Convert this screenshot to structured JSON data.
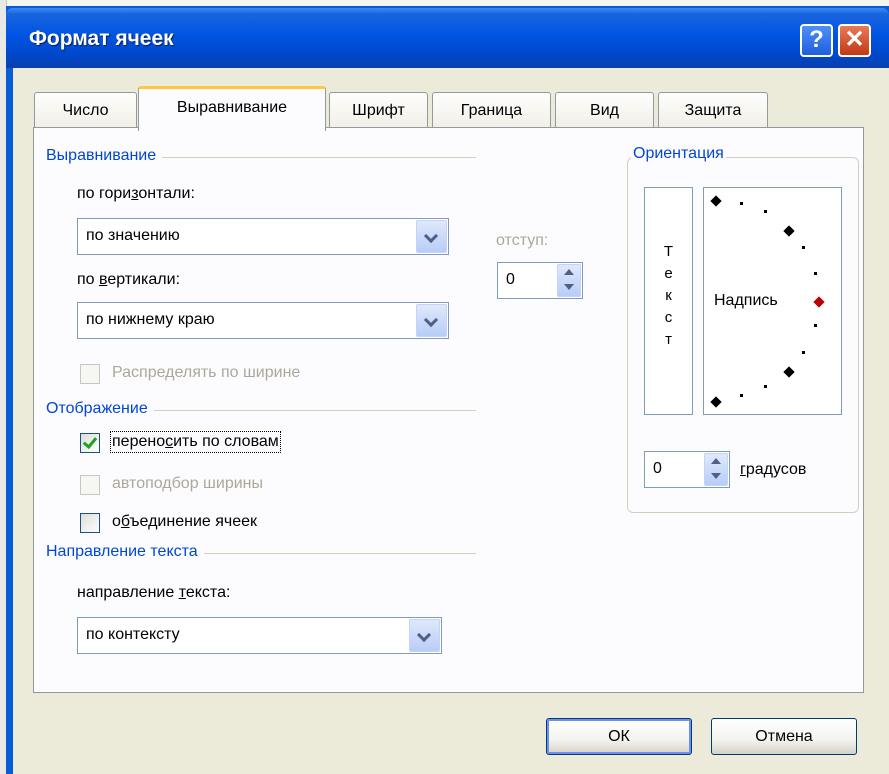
{
  "window": {
    "title": "Формат ячеек"
  },
  "title_buttons": {
    "help": "?",
    "close": "✕"
  },
  "tabs": [
    {
      "label": "Число",
      "active": false
    },
    {
      "label": "Выравнивание",
      "active": true
    },
    {
      "label": "Шрифт",
      "active": false
    },
    {
      "label": "Граница",
      "active": false
    },
    {
      "label": "Вид",
      "active": false
    },
    {
      "label": "Защита",
      "active": false
    }
  ],
  "alignment": {
    "group_title": "Выравнивание",
    "horizontal_label_pre": "по гори",
    "horizontal_label_ul": "з",
    "horizontal_label_post": "онтали:",
    "horizontal_value": "по значению",
    "indent_label": "отступ:",
    "indent_value": "0",
    "vertical_label_pre": "по ",
    "vertical_label_ul": "в",
    "vertical_label_post": "ертикали:",
    "vertical_value": "по нижнему краю",
    "distribute_label": "Распределять по ширине"
  },
  "display": {
    "group_title": "Отображение",
    "wrap_pre": "перено",
    "wrap_ul": "с",
    "wrap_post": "ить по словам",
    "wrap_checked": true,
    "shrink_label": "автоподбор ширины",
    "merge_pre": "о",
    "merge_ul": "б",
    "merge_post": "ъединение ячеек",
    "merge_checked": false
  },
  "direction": {
    "group_title": "Направление текста",
    "label_pre": "направление ",
    "label_ul": "т",
    "label_post": "екста:",
    "value": "по контексту"
  },
  "orientation": {
    "group_title": "Ориентация",
    "vertical_chars": [
      "Т",
      "е",
      "к",
      "с",
      "т"
    ],
    "arc_label": "Надпись",
    "degrees_value": "0",
    "degrees_ul": "г",
    "degrees_post": "радусов"
  },
  "buttons": {
    "ok": "ОК",
    "cancel": "Отмена"
  },
  "colors": {
    "titlebar": "#0054e3",
    "group_title": "#0046d5",
    "panel": "#fcfcfe",
    "client": "#ecead9",
    "active_tab_accent": "#ffc83c",
    "check_mark": "#21a121",
    "arc_marker": "#c00000"
  }
}
